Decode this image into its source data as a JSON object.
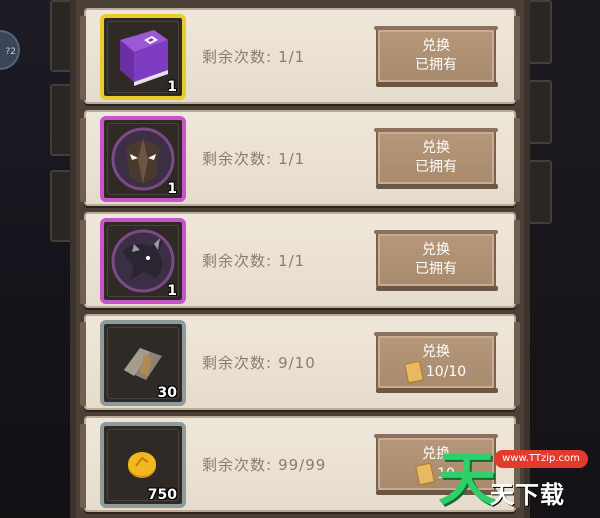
{
  "side_button_label": "?2",
  "rows": [
    {
      "item": "book-icon",
      "qty": "1",
      "remain_label": "剩余次数:",
      "remain_value": "1/1",
      "btn_title": "兑换",
      "btn_sub": "已拥有",
      "frame": "gold"
    },
    {
      "item": "mask-icon",
      "qty": "1",
      "remain_label": "剩余次数:",
      "remain_value": "1/1",
      "btn_title": "兑换",
      "btn_sub": "已拥有",
      "frame": "purple"
    },
    {
      "item": "dragon-icon",
      "qty": "1",
      "remain_label": "剩余次数:",
      "remain_value": "1/1",
      "btn_title": "兑换",
      "btn_sub": "已拥有",
      "frame": "purple"
    },
    {
      "item": "map-scrap-icon",
      "qty": "30",
      "remain_label": "剩余次数:",
      "remain_value": "9/10",
      "btn_title": "兑换",
      "btn_cost": "10/10",
      "frame": "gray"
    },
    {
      "item": "gold-coin-icon",
      "qty": "750",
      "remain_label": "剩余次数:",
      "remain_value": "99/99",
      "btn_title": "兑换",
      "btn_cost": "10",
      "frame": "gray"
    }
  ],
  "watermark": {
    "url": "www.TTzip.com",
    "big": "天",
    "text": "天下载"
  },
  "colors": {
    "gold_frame": "#e8cc2a",
    "purple_frame": "#c556c9",
    "gray_frame": "#8f9a9a",
    "button": "#b6977a"
  }
}
